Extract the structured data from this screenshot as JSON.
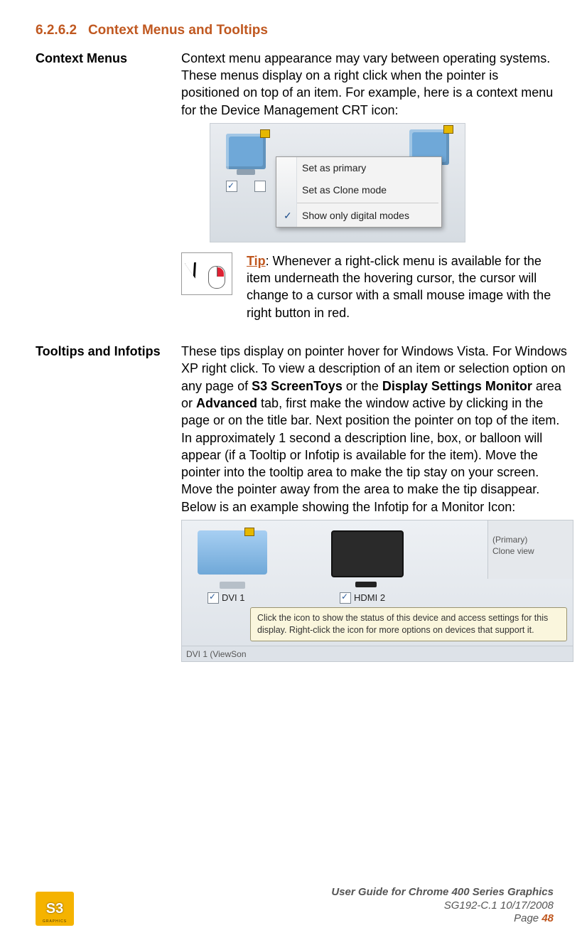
{
  "section": {
    "number": "6.2.6.2",
    "title": "Context Menus and Tooltips"
  },
  "contextMenus": {
    "label": "Context Menus",
    "paragraph": "Context menu appearance may vary between operating systems. These menus display on a right click when the pointer is positioned on top of an item. For example, here is a context menu for the Device Management CRT icon:",
    "menu": {
      "items": [
        "Set as primary",
        "Set as Clone mode"
      ],
      "checkedItem": "Show only digital modes"
    },
    "tip": {
      "label": "Tip",
      "text": ": Whenever a right-click menu is available for the item underneath the hovering cursor, the cursor will change to a cursor with a small mouse image with the right button in red."
    }
  },
  "tooltipsInfotips": {
    "label": "Tooltips and Infotips",
    "paragraph_pre": "These tips display on pointer hover for Windows Vista. For Windows XP right click. To view a description of an item or selection option on any page of ",
    "bold1": "S3 ScreenToys",
    "paragraph_mid1": " or the ",
    "bold2": "Display Settings Monitor",
    "paragraph_mid2": " area or ",
    "bold3": "Advanced",
    "paragraph_post": " tab, first make the window active by clicking in the page or on the title bar. Next position the pointer on top of the item. In approximately 1 second a description line, box, or balloon will appear (if a Tooltip or Infotip is available for the item). Move the pointer into the tooltip area to make the tip stay on your screen. Move the pointer away from the area to make the tip disappear. Below is an example showing the Infotip for a Monitor Icon:",
    "infotip": {
      "dviLabel": "DVI 1",
      "hdmiLabel": "HDMI 2",
      "primary": "(Primary)",
      "clone": "Clone view",
      "tooltipText": "Click the icon to show the status of this device and access settings for this display. Right-click the icon for more options on devices that support it.",
      "bottomLabel": "DVI 1 (ViewSon"
    }
  },
  "footer": {
    "logoText": "S3",
    "logoSub": "GRAPHICS",
    "title": "User Guide for Chrome 400 Series Graphics",
    "doc": "SG192-C.1   10/17/2008",
    "pageLabel": "Page ",
    "pageNo": "48"
  }
}
